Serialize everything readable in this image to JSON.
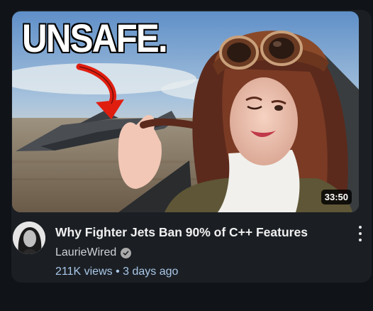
{
  "video": {
    "thumbnail_text": "UNSAFE.",
    "duration": "33:50",
    "title": "Why Fighter Jets Ban 90% of C++ Features",
    "channel": "LaurieWired",
    "views": "211K views",
    "separator": "•",
    "age": "3 days ago"
  },
  "icons": {
    "verified": "verified-check-icon",
    "more": "more-vertical-icon"
  },
  "colors": {
    "background": "#101317",
    "card": "#1b1f24",
    "meta_text": "#a9c7e8",
    "title_text": "#f1f1f1"
  }
}
